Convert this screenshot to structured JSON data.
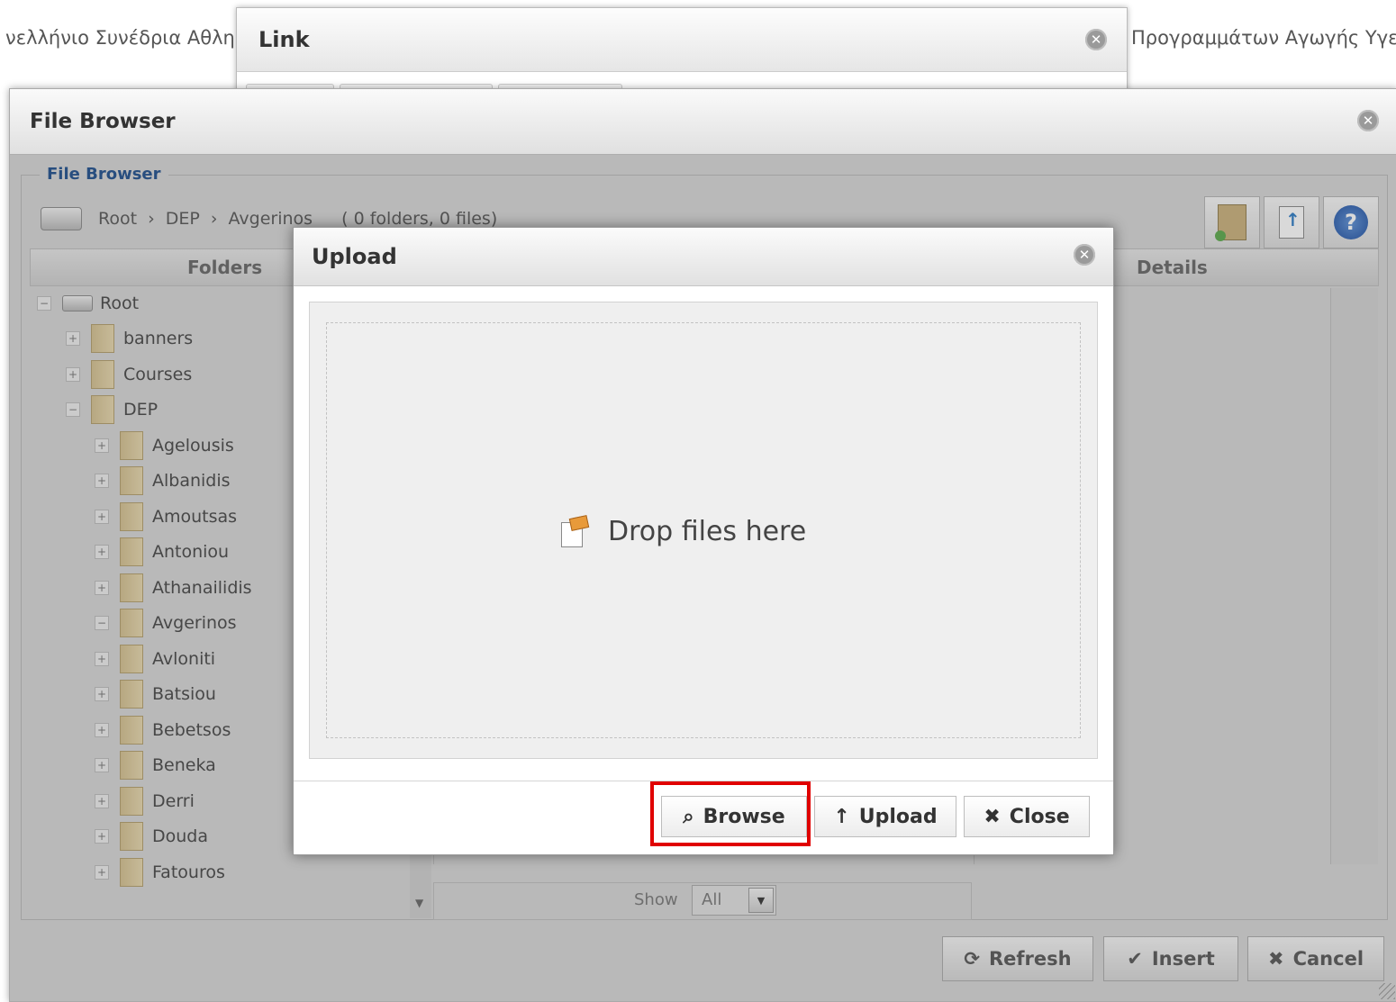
{
  "background": {
    "left_text": "νελλήνιο Συνέδρια Αθλη",
    "right_text": "Προγραμμάτων Αγωγής Υγε"
  },
  "link_dialog": {
    "title": "Link",
    "close_icon": "close-icon"
  },
  "file_browser": {
    "title": "File Browser",
    "legend": "File Browser",
    "breadcrumb": [
      "Root",
      "›",
      "DEP",
      "›",
      "Avgerinos"
    ],
    "summary": "( 0 folders, 0 files)",
    "toolbar_icons": [
      "new-folder-icon",
      "upload-icon",
      "help-icon"
    ],
    "columns": {
      "folders": "Folders",
      "details": "Details"
    },
    "tree": [
      {
        "label": "Root",
        "toggle": "−",
        "level": "root"
      },
      {
        "label": "banners",
        "toggle": "+",
        "level": "1"
      },
      {
        "label": "Courses",
        "toggle": "+",
        "level": "1"
      },
      {
        "label": "DEP",
        "toggle": "−",
        "level": "1"
      },
      {
        "label": "Agelousis",
        "toggle": "+",
        "level": "2"
      },
      {
        "label": "Albanidis",
        "toggle": "+",
        "level": "2"
      },
      {
        "label": "Amoutsas",
        "toggle": "+",
        "level": "2"
      },
      {
        "label": "Antoniou",
        "toggle": "+",
        "level": "2"
      },
      {
        "label": "Athanailidis",
        "toggle": "+",
        "level": "2"
      },
      {
        "label": "Avgerinos",
        "toggle": "−",
        "level": "2"
      },
      {
        "label": "Avloniti",
        "toggle": "+",
        "level": "2"
      },
      {
        "label": "Batsiou",
        "toggle": "+",
        "level": "2"
      },
      {
        "label": "Bebetsos",
        "toggle": "+",
        "level": "2"
      },
      {
        "label": "Beneka",
        "toggle": "+",
        "level": "2"
      },
      {
        "label": "Derri",
        "toggle": "+",
        "level": "2"
      },
      {
        "label": "Douda",
        "toggle": "+",
        "level": "2"
      },
      {
        "label": "Fatouros",
        "toggle": "+",
        "level": "2"
      }
    ],
    "show": {
      "label": "Show",
      "value": "All"
    },
    "buttons": {
      "refresh": "Refresh",
      "insert": "Insert",
      "cancel": "Cancel"
    }
  },
  "upload_dialog": {
    "title": "Upload",
    "drop_text": "Drop files here",
    "buttons": {
      "browse": "Browse",
      "upload": "Upload",
      "close": "Close"
    },
    "highlight_color": "#e00000"
  }
}
